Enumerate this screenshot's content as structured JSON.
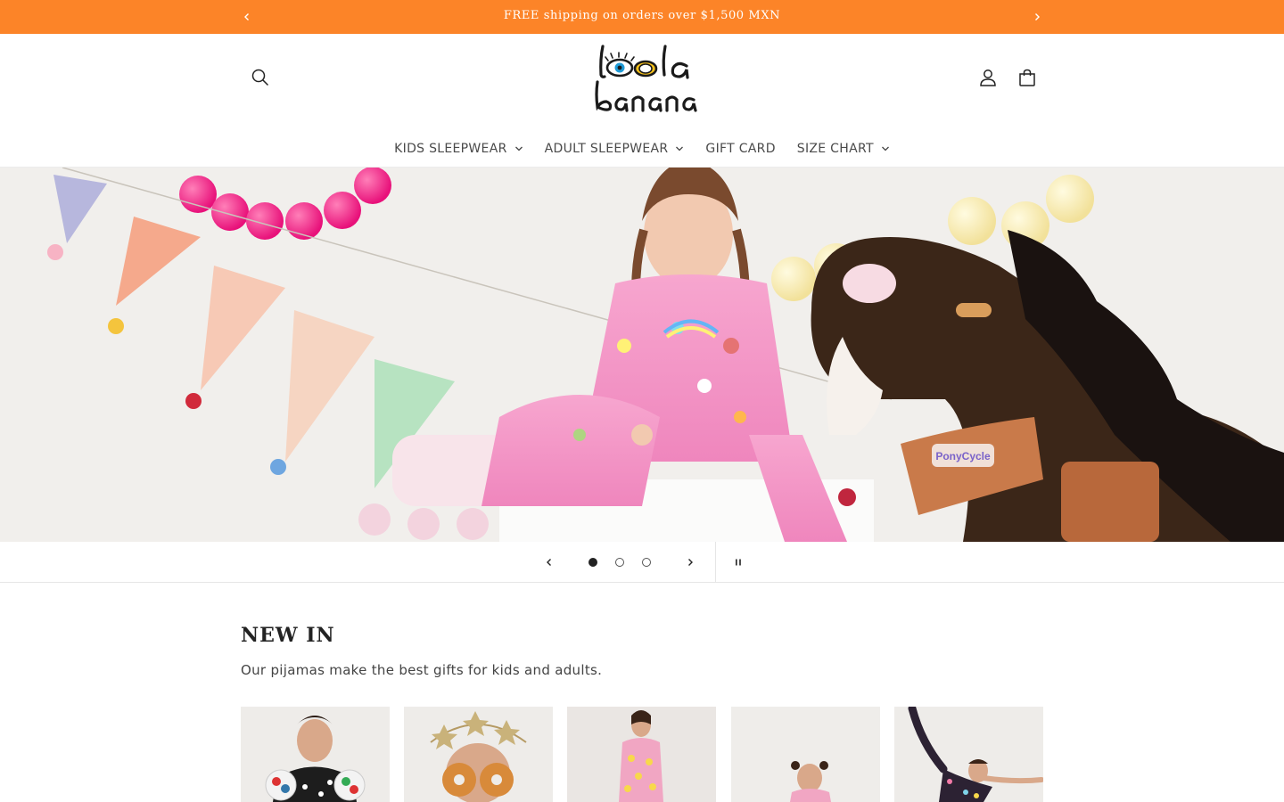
{
  "announcement": {
    "text": "FREE shipping on orders over $1,500 MXN",
    "bg_color": "#fc8428",
    "prev_icon": "chevron-left-icon",
    "next_icon": "chevron-right-icon"
  },
  "header": {
    "logo_text_top": "lola",
    "logo_text_bottom": "banana",
    "search_icon": "search-icon",
    "account_icon": "account-icon",
    "cart_icon": "cart-icon"
  },
  "nav": {
    "items": [
      {
        "label": "KIDS SLEEPWEAR",
        "has_dropdown": true
      },
      {
        "label": "ADULT SLEEPWEAR",
        "has_dropdown": true
      },
      {
        "label": "GIFT CARD",
        "has_dropdown": false
      },
      {
        "label": "SIZE CHART",
        "has_dropdown": true
      }
    ]
  },
  "hero": {
    "description": "Girl in pink pajamas sitting beside a plush pony",
    "saddle_badge_text": "PonyCycle"
  },
  "slider": {
    "slide_count": 3,
    "active_slide": 1,
    "prev_icon": "chevron-left-icon",
    "next_icon": "chevron-right-icon",
    "pause_icon": "pause-icon"
  },
  "new_in": {
    "title": "NEW IN",
    "subtitle": "Our pijamas make the best gifts for kids and adults.",
    "products": [
      {
        "alt": "Boy in black pajamas holding balls"
      },
      {
        "alt": "Girl with donuts over eyes and star crown"
      },
      {
        "alt": "Girl in pink printed pajamas"
      },
      {
        "alt": "Girl in pink pajamas"
      },
      {
        "alt": "Girl in dark printed pajamas stretching"
      }
    ]
  }
}
